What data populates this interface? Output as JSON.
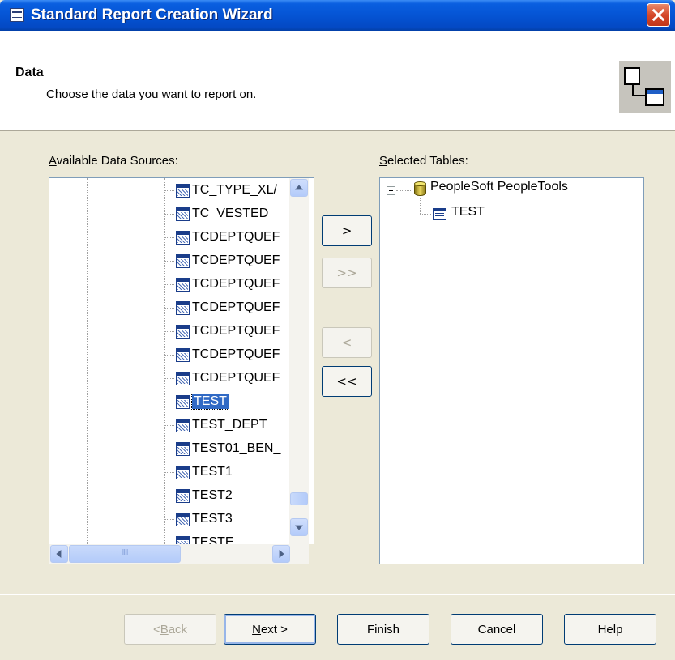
{
  "window": {
    "title": "Standard Report Creation Wizard"
  },
  "header": {
    "title": "Data",
    "subtitle": "Choose the data you want to report on."
  },
  "available": {
    "label_first": "A",
    "label_rest": "vailable Data Sources:",
    "items": [
      {
        "label": "TC_TYPE_XL/"
      },
      {
        "label": "TC_VESTED_"
      },
      {
        "label": "TCDEPTQUEF"
      },
      {
        "label": "TCDEPTQUEF"
      },
      {
        "label": "TCDEPTQUEF"
      },
      {
        "label": "TCDEPTQUEF"
      },
      {
        "label": "TCDEPTQUEF"
      },
      {
        "label": "TCDEPTQUEF"
      },
      {
        "label": "TCDEPTQUEF"
      },
      {
        "label": "TEST",
        "selected": true
      },
      {
        "label": "TEST_DEPT"
      },
      {
        "label": "TEST01_BEN_"
      },
      {
        "label": "TEST1"
      },
      {
        "label": "TEST2"
      },
      {
        "label": "TEST3"
      },
      {
        "label": "TESTE"
      }
    ]
  },
  "transfer": {
    "add": ">",
    "add_all": ">>",
    "remove": "<",
    "remove_all": "<<"
  },
  "selected": {
    "label_first": "S",
    "label_rest": "elected Tables:",
    "root": "PeopleSoft PeopleTools",
    "child": "TEST"
  },
  "footer": {
    "back_prefix": "< ",
    "back_u": "B",
    "back_rest": "ack",
    "next_u": "N",
    "next_rest": "ext >",
    "finish": "Finish",
    "cancel": "Cancel",
    "help": "Help"
  }
}
